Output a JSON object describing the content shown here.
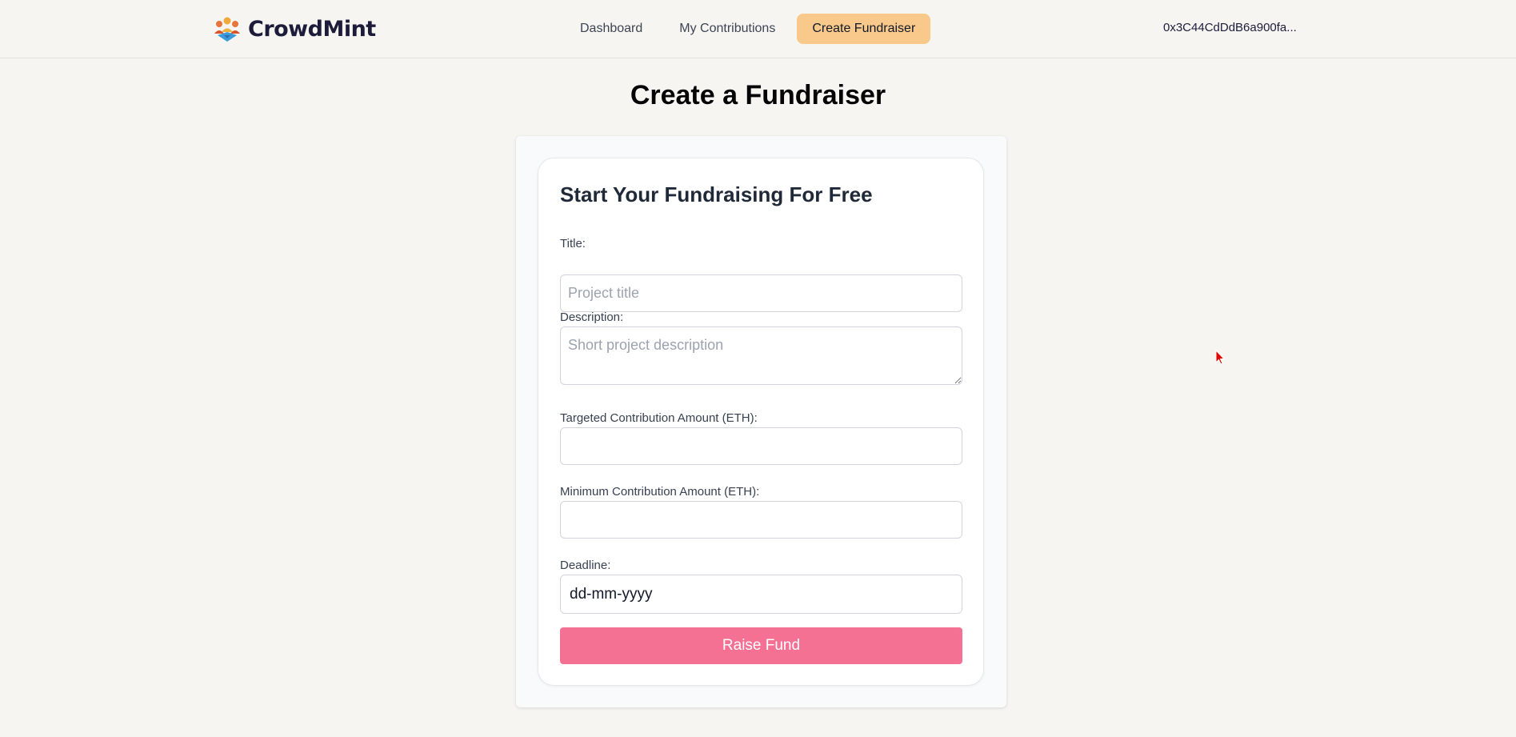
{
  "brand": {
    "name": "CrowdMint",
    "logo_icon": "crowd-people-logo-icon"
  },
  "nav": {
    "links": [
      "Dashboard",
      "My Contributions",
      "Create Fundraiser"
    ],
    "active": "Create Fundraiser",
    "wallet_address": "0x3C44CdDdB6a900fa..."
  },
  "page": {
    "title": "Create a Fundraiser"
  },
  "form": {
    "heading": "Start Your Fundraising For Free",
    "title_label": "Title:",
    "title_placeholder": "Project title",
    "description_label": "Description:",
    "description_placeholder": "Short project description",
    "target_label": "Targeted Contribution Amount (ETH):",
    "minimum_label": "Minimum Contribution Amount (ETH):",
    "deadline_label": "Deadline:",
    "deadline_placeholder": "dd-mm-yyyy",
    "submit_label": "Raise Fund"
  },
  "colors": {
    "background": "#f6f5f2",
    "active_nav": "#f8c98a",
    "submit_button": "#f47194",
    "cursor": "#e00000"
  }
}
